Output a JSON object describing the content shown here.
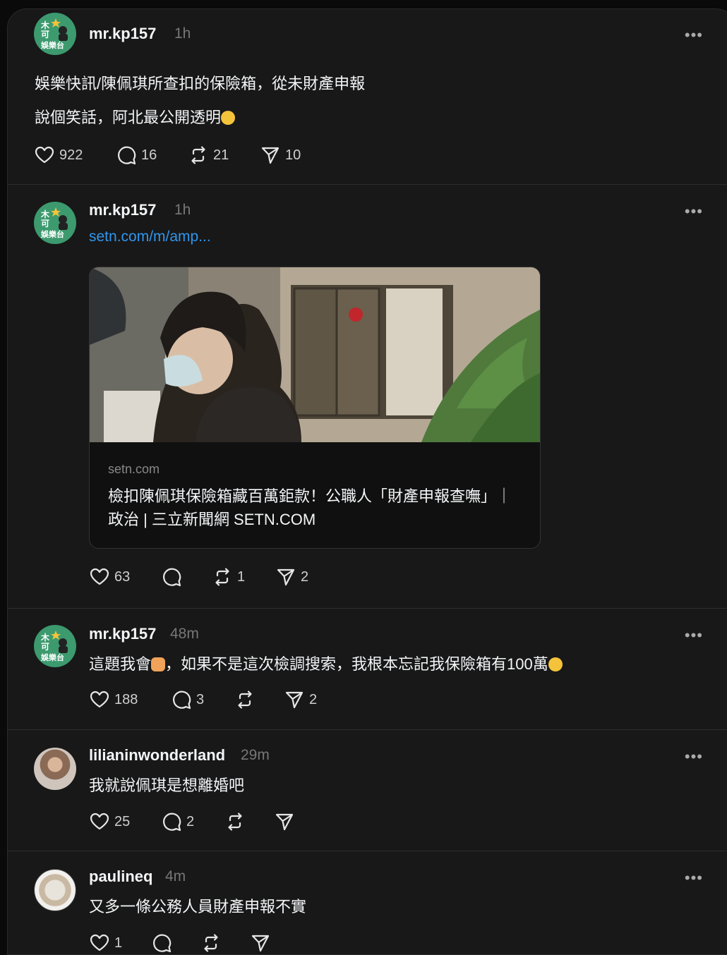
{
  "posts": [
    {
      "username": "mr.kp157",
      "time": "1h",
      "avatar_text": "木可 娛樂台",
      "lines": [
        "娛樂快訊/陳佩琪所查扣的保險箱，從未財產申報",
        "說個笑話，阿北最公開透明"
      ],
      "likes": "922",
      "comments": "16",
      "reposts": "21",
      "shares": "10"
    },
    {
      "username": "mr.kp157",
      "time": "1h",
      "avatar_text": "木可 娛樂台",
      "link": "setn.com/m/amp...",
      "card": {
        "domain": "setn.com",
        "title": "檢扣陳佩琪保險箱藏百萬鉅款！公職人「財產申報查嘸」｜政治 | 三立新聞網 SETN.COM"
      },
      "likes": "63",
      "comments": "",
      "reposts": "1",
      "shares": "2"
    },
    {
      "username": "mr.kp157",
      "time": "48m",
      "avatar_text": "木可 娛樂台",
      "line_a": "這題我會",
      "line_b": "，如果不是這次檢調搜索，我根本忘記我保險箱有100萬",
      "likes": "188",
      "comments": "3",
      "reposts": "",
      "shares": "2"
    },
    {
      "username": "lilianinwonderland",
      "time": "29m",
      "line": "我就說佩琪是想離婚吧",
      "likes": "25",
      "comments": "2",
      "reposts": "",
      "shares": ""
    },
    {
      "username": "paulineq",
      "time": "4m",
      "line": "又多一條公務人員財產申報不實",
      "likes": "1",
      "comments": "",
      "reposts": "",
      "shares": ""
    }
  ],
  "icons": [
    "heart-icon",
    "comment-icon",
    "repost-icon",
    "share-icon",
    "more-icon"
  ],
  "colors": {
    "background": "#181818",
    "link": "#2f96ef",
    "muted": "#777777",
    "avatar_green": "#3c9a6e"
  }
}
